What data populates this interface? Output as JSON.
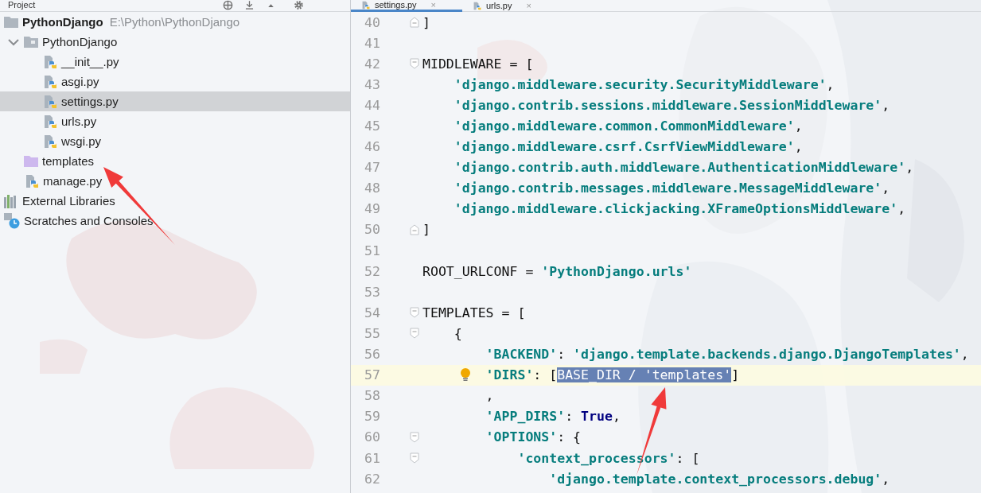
{
  "project_panel": {
    "title": "Project",
    "toolbar": [
      {
        "kind": "locate"
      },
      {
        "kind": "collapse"
      },
      {
        "kind": "up"
      },
      {
        "kind": "settings"
      }
    ],
    "tree": [
      {
        "label": "PythonDjango",
        "path": "E:\\Python\\PythonDjango",
        "kind": "project-root",
        "selected": false,
        "children": [
          {
            "label": "PythonDjango",
            "kind": "folder",
            "expanded": true,
            "selected": false,
            "children": [
              {
                "label": "__init__.py",
                "kind": "python-file",
                "selected": false
              },
              {
                "label": "asgi.py",
                "kind": "python-file",
                "selected": false
              },
              {
                "label": "settings.py",
                "kind": "python-file",
                "selected": true
              },
              {
                "label": "urls.py",
                "kind": "python-file",
                "selected": false
              },
              {
                "label": "wsgi.py",
                "kind": "python-file",
                "selected": false
              }
            ]
          },
          {
            "label": "templates",
            "kind": "template-folder",
            "selected": false
          },
          {
            "label": "manage.py",
            "kind": "python-file",
            "selected": false
          }
        ]
      },
      {
        "label": "External Libraries",
        "kind": "libraries",
        "selected": false
      },
      {
        "label": "Scratches and Consoles",
        "kind": "scratches",
        "selected": false
      }
    ]
  },
  "editor": {
    "tabs": [
      {
        "label": "settings.py",
        "selected": true,
        "close": "×"
      },
      {
        "label": "urls.py",
        "selected": false,
        "close": "×"
      }
    ],
    "lines": [
      {
        "number": "40",
        "marker": {
          "kind": "fold-end"
        },
        "current": false,
        "segments": [
          {
            "text": "]",
            "kind": "plain"
          }
        ]
      },
      {
        "number": "41",
        "current": false
      },
      {
        "number": "42",
        "marker": {
          "kind": "fold-start"
        },
        "current": false,
        "segments": [
          {
            "text": "MIDDLEWARE = [",
            "kind": "plain"
          }
        ]
      },
      {
        "number": "43",
        "current": false,
        "segments": [
          {
            "text": "    'django.middleware.security.SecurityMiddleware'",
            "kind": "string"
          },
          {
            "text": ",",
            "kind": "plain"
          }
        ]
      },
      {
        "number": "44",
        "current": false,
        "segments": [
          {
            "text": "    'django.contrib.sessions.middleware.SessionMiddleware'",
            "kind": "string"
          },
          {
            "text": ",",
            "kind": "plain"
          }
        ]
      },
      {
        "number": "45",
        "current": false,
        "segments": [
          {
            "text": "    'django.middleware.common.CommonMiddleware'",
            "kind": "string"
          },
          {
            "text": ",",
            "kind": "plain"
          }
        ]
      },
      {
        "number": "46",
        "current": false,
        "segments": [
          {
            "text": "    'django.middleware.csrf.CsrfViewMiddleware'",
            "kind": "string"
          },
          {
            "text": ",",
            "kind": "plain"
          }
        ]
      },
      {
        "number": "47",
        "current": false,
        "segments": [
          {
            "text": "    'django.contrib.auth.middleware.AuthenticationMiddleware'",
            "kind": "string"
          },
          {
            "text": ",",
            "kind": "plain"
          }
        ]
      },
      {
        "number": "48",
        "current": false,
        "segments": [
          {
            "text": "    'django.contrib.messages.middleware.MessageMiddleware'",
            "kind": "string"
          },
          {
            "text": ",",
            "kind": "plain"
          }
        ]
      },
      {
        "number": "49",
        "current": false,
        "segments": [
          {
            "text": "    'django.middleware.clickjacking.XFrameOptionsMiddleware'",
            "kind": "string"
          },
          {
            "text": ",",
            "kind": "plain"
          }
        ]
      },
      {
        "number": "50",
        "marker": {
          "kind": "fold-end"
        },
        "current": false,
        "segments": [
          {
            "text": "]",
            "kind": "plain"
          }
        ]
      },
      {
        "number": "51",
        "current": false
      },
      {
        "number": "52",
        "current": false,
        "segments": [
          {
            "text": "ROOT_URLCONF = ",
            "kind": "plain"
          },
          {
            "text": "'PythonDjango.urls'",
            "kind": "string"
          }
        ]
      },
      {
        "number": "53",
        "current": false
      },
      {
        "number": "54",
        "marker": {
          "kind": "fold-start"
        },
        "current": false,
        "segments": [
          {
            "text": "TEMPLATES = [",
            "kind": "plain"
          }
        ]
      },
      {
        "number": "55",
        "marker": {
          "kind": "fold-start"
        },
        "current": false,
        "segments": [
          {
            "text": "    {",
            "kind": "plain"
          }
        ]
      },
      {
        "number": "56",
        "current": false,
        "segments": [
          {
            "text": "        'BACKEND'",
            "kind": "string"
          },
          {
            "text": ": ",
            "kind": "plain"
          },
          {
            "text": "'django.template.backends.django.DjangoTemplates'",
            "kind": "string"
          },
          {
            "text": ",",
            "kind": "plain"
          }
        ]
      },
      {
        "number": "57",
        "marker": {
          "kind": "bulb"
        },
        "current": true,
        "segments": [
          {
            "text": "        'DIRS'",
            "kind": "string"
          },
          {
            "text": ": [",
            "kind": "plain"
          },
          {
            "text": "BASE_DIR / 'templates'",
            "kind": "selection"
          },
          {
            "text": "]",
            "kind": "plain"
          }
        ]
      },
      {
        "number": "58",
        "current": false,
        "segments": [
          {
            "text": "        ,",
            "kind": "plain"
          }
        ]
      },
      {
        "number": "59",
        "current": false,
        "segments": [
          {
            "text": "        'APP_DIRS'",
            "kind": "string"
          },
          {
            "text": ": ",
            "kind": "plain"
          },
          {
            "text": "True",
            "kind": "keyword"
          },
          {
            "text": ",",
            "kind": "plain"
          }
        ]
      },
      {
        "number": "60",
        "marker": {
          "kind": "fold-start"
        },
        "current": false,
        "segments": [
          {
            "text": "        'OPTIONS'",
            "kind": "string"
          },
          {
            "text": ": {",
            "kind": "plain"
          }
        ]
      },
      {
        "number": "61",
        "marker": {
          "kind": "fold-start"
        },
        "current": false,
        "segments": [
          {
            "text": "            'context_processors'",
            "kind": "string"
          },
          {
            "text": ": [",
            "kind": "plain"
          }
        ]
      },
      {
        "number": "62",
        "current": false,
        "segments": [
          {
            "text": "                'django.template.context_processors.debug'",
            "kind": "string"
          },
          {
            "text": ",",
            "kind": "plain"
          }
        ]
      }
    ]
  },
  "annotations": [
    {
      "kind": "arrow",
      "color": "#f03a3a"
    },
    {
      "kind": "arrow",
      "color": "#f03a3a"
    }
  ]
}
